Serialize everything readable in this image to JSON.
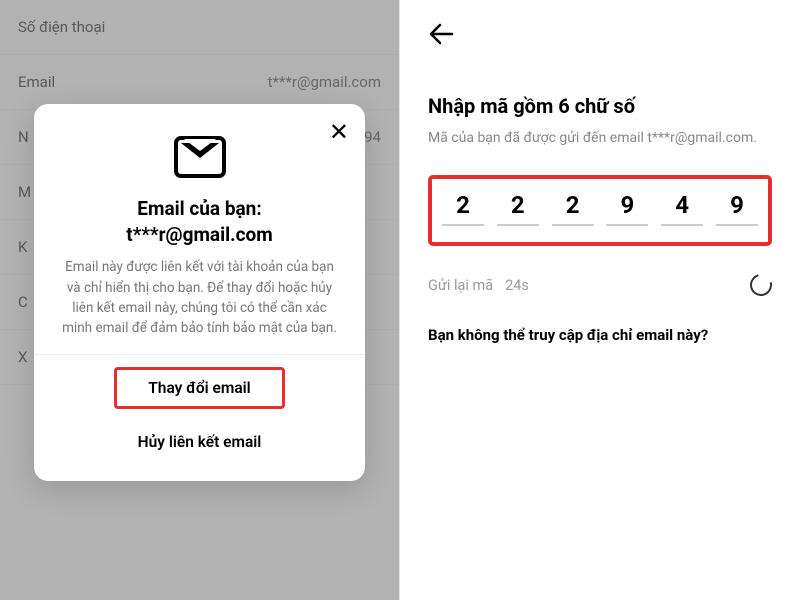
{
  "left_bg": {
    "rows": [
      {
        "label": "Số điện thoại",
        "value": ""
      },
      {
        "label": "Email",
        "value": "t***r@gmail.com"
      },
      {
        "label": "N",
        "value": "94"
      },
      {
        "label": "M",
        "value": ""
      },
      {
        "label": "K",
        "value": ""
      },
      {
        "label": "C",
        "value": ""
      },
      {
        "label": "X",
        "value": ""
      }
    ]
  },
  "modal": {
    "title_line1": "Email của bạn:",
    "title_line2": "t***r@gmail.com",
    "desc": "Email này được liên kết với tài khoản của bạn và chỉ hiển thị cho bạn. Để thay đổi hoặc hủy liên kết email này, chúng tôi có thể cần xác minh email để đảm bảo tính bảo mật của bạn.",
    "change_btn": "Thay đổi email",
    "unlink_btn": "Hủy liên kết email"
  },
  "right": {
    "title": "Nhập mã gồm 6 chữ số",
    "subtitle": "Mã của bạn đã được gửi đến email t***r@gmail.com.",
    "digits": [
      "2",
      "2",
      "2",
      "9",
      "4",
      "9"
    ],
    "resend_label": "Gửi lại mã",
    "countdown": "24s",
    "cannot_access": "Bạn không thể truy cập địa chỉ email này?"
  }
}
